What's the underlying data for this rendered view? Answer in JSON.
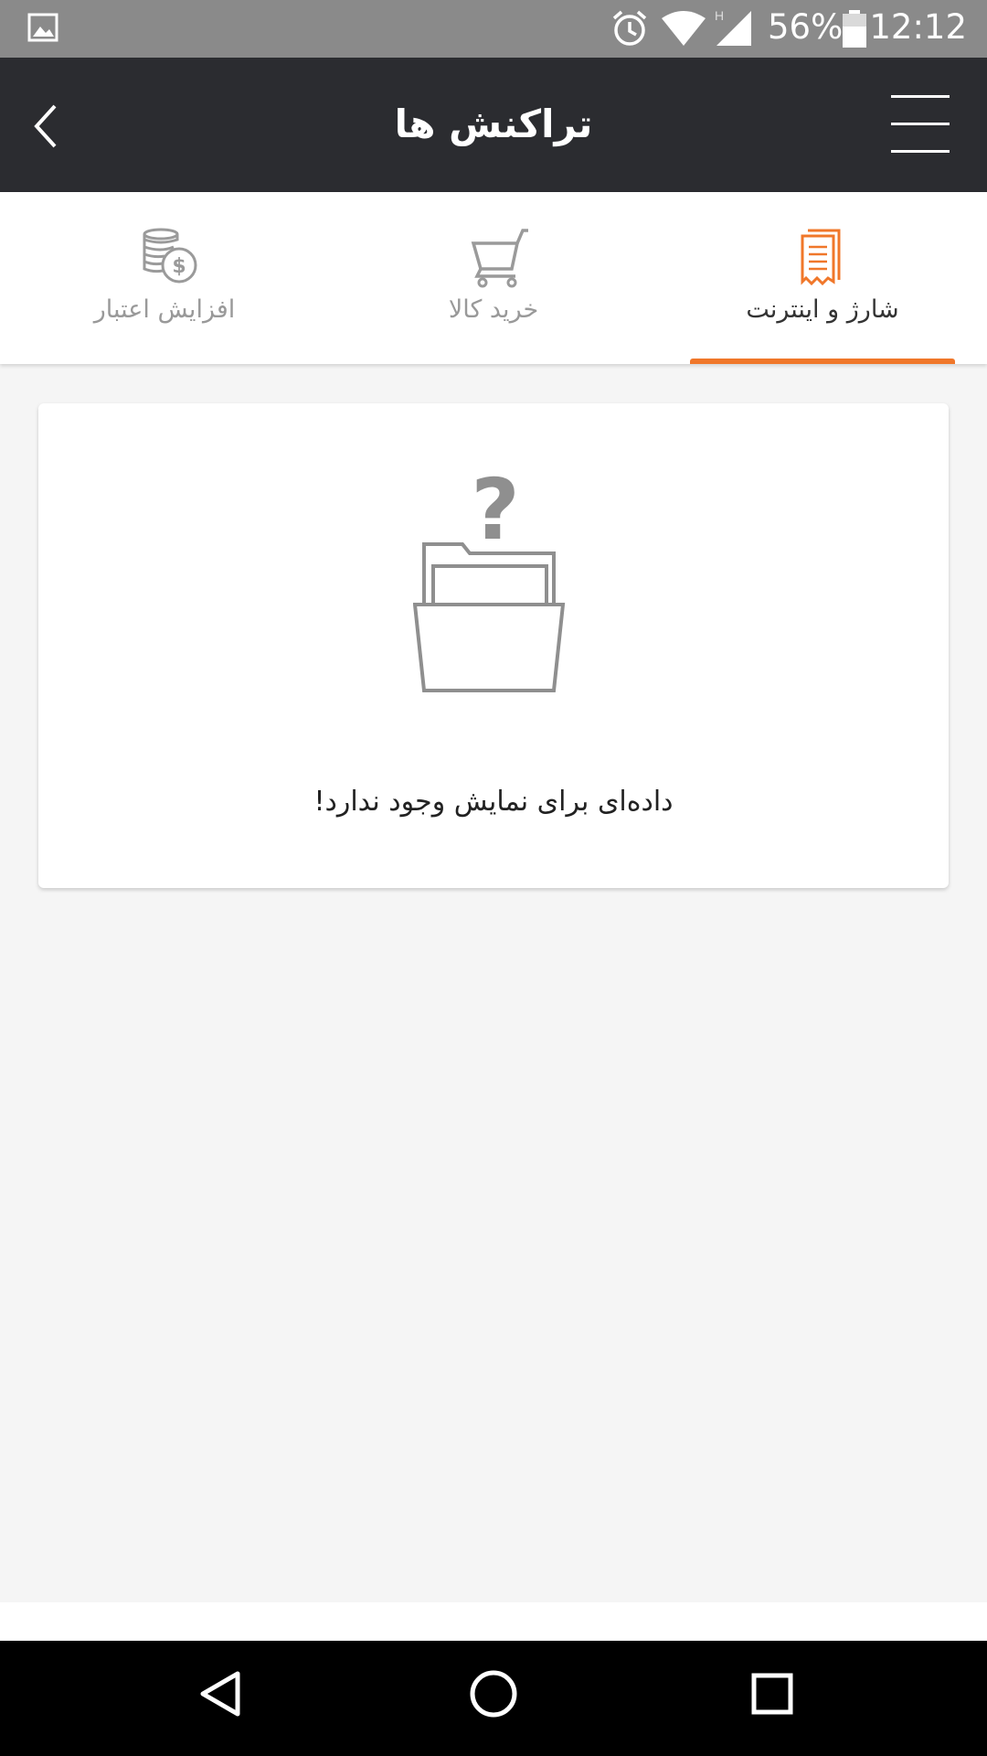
{
  "status_bar": {
    "battery_percent": "56%",
    "time": "12:12",
    "network_label": "H"
  },
  "app_bar": {
    "title": "تراکنش ها"
  },
  "tabs": [
    {
      "label": "شارژ و اینترنت",
      "icon": "receipt-icon",
      "active": true
    },
    {
      "label": "خرید کالا",
      "icon": "cart-icon",
      "active": false
    },
    {
      "label": "افزایش اعتبار",
      "icon": "coins-icon",
      "active": false
    }
  ],
  "empty_state": {
    "message": "داده‌ای برای نمایش وجود ندارد!"
  },
  "colors": {
    "accent": "#f0772a",
    "app_bar": "#2b2c30",
    "status_bar": "#8a8a8a",
    "background": "#f5f5f5"
  }
}
